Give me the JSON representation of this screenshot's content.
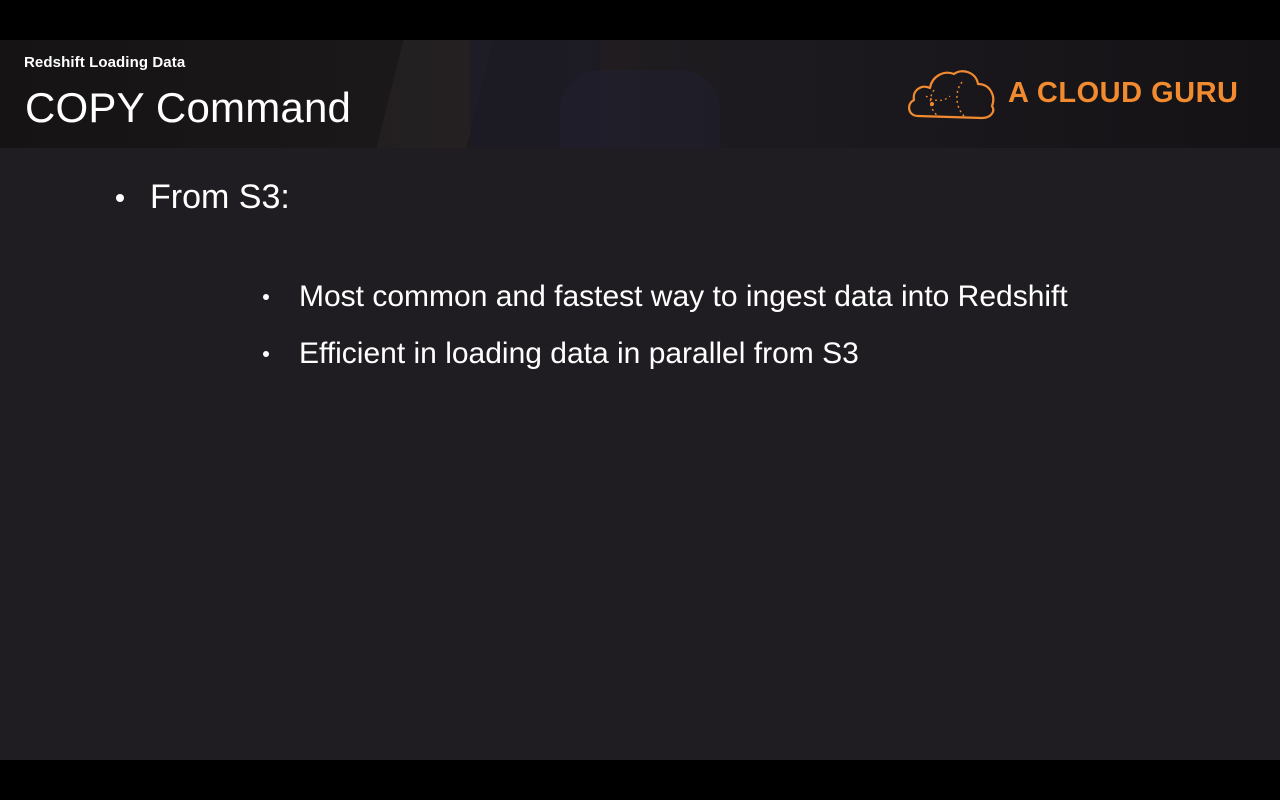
{
  "slide": {
    "subtitle": "Redshift Loading Data",
    "title": "COPY Command",
    "logo_text": "A CLOUD GURU",
    "accent_color": "#f28b30",
    "bullets": [
      {
        "text": "From S3:",
        "children": [
          "Most common and fastest way to ingest data into Redshift",
          "Efficient in loading data in parallel from S3"
        ]
      }
    ]
  }
}
